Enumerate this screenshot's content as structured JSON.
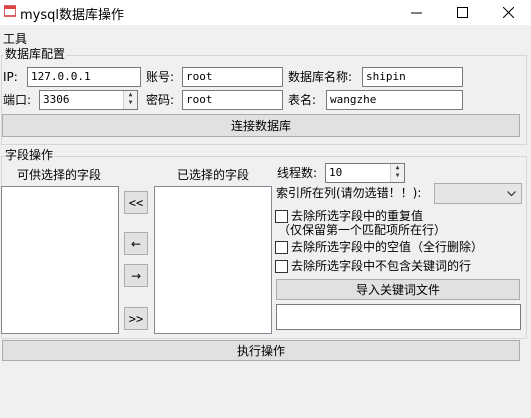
{
  "window": {
    "title": "mysql数据库操作"
  },
  "menu": {
    "tools": "工具"
  },
  "db_group": {
    "title": "数据库配置",
    "ip_label": "IP:",
    "ip_value": "127.0.0.1",
    "account_label": "账号:",
    "account_value": "root",
    "dbname_label": "数据库名称:",
    "dbname_value": "shipin",
    "port_label": "端口:",
    "port_value": "3306",
    "password_label": "密码:",
    "password_value": "root",
    "table_label": "表名:",
    "table_value": "wangzhe",
    "connect_button": "连接数据库"
  },
  "field_group": {
    "title": "字段操作",
    "available_label": "可供选择的字段",
    "selected_label": "已选择的字段",
    "move_all_left": "<<",
    "move_left": "←",
    "move_right": "→",
    "move_all_right": ">>",
    "threads_label": "线程数:",
    "threads_value": "10",
    "index_col_label": "索引所在列(请勿选错！！):",
    "index_col_value": "",
    "dedupe_label": "去除所选字段中的重复值",
    "dedupe_note": "（仅保留第一个匹配项所在行）",
    "remove_empty_label": "去除所选字段中的空值（全行删除）",
    "remove_no_keyword_label": "去除所选字段中不包含关键词的行",
    "import_keywords_button": "导入关键词文件",
    "keywords_path_value": ""
  },
  "execute_button": "执行操作"
}
